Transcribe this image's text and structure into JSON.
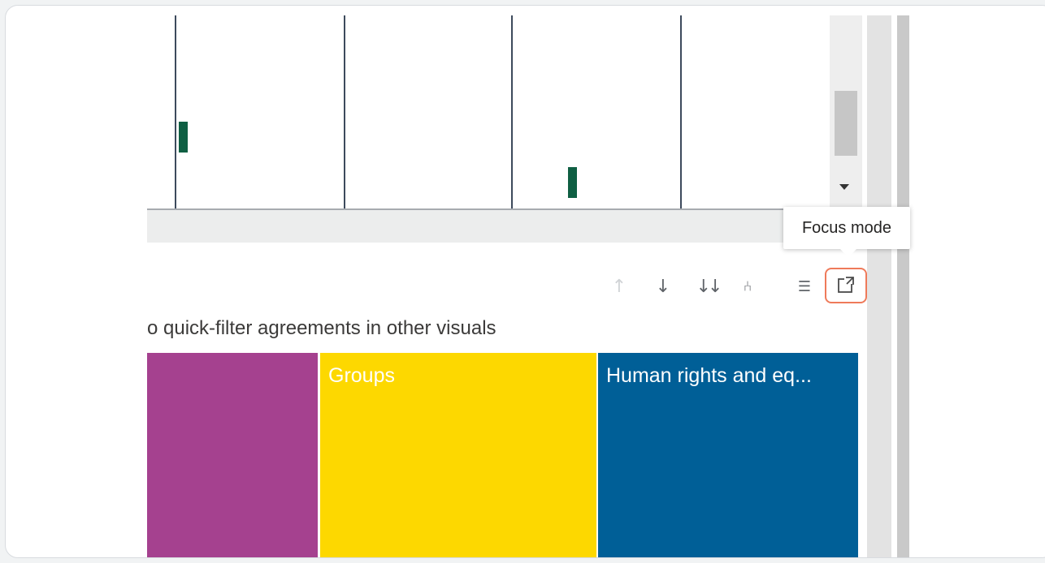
{
  "tooltip": {
    "text": "Focus mode"
  },
  "visual": {
    "subtitle": "o quick-filter agreements in other visuals",
    "toolbar": {
      "drill_up_icon": "↑",
      "drill_down_icon": "↓",
      "expand_all_icon": "↓↓",
      "expand_hierarchy_icon": "⑃",
      "filter_icon": "☰",
      "focus_mode_icon": "⤢"
    }
  },
  "chart_data": {
    "type": "bar",
    "series": [
      {
        "name": "",
        "color": "#0f5f43"
      }
    ],
    "note_visible_marks": 2
  },
  "treemap": {
    "tiles": [
      {
        "label": "",
        "color": "#a5418f"
      },
      {
        "label": "Groups",
        "color": "#fdd800"
      },
      {
        "label": "Human rights and eq...",
        "color": "#005f97"
      }
    ]
  }
}
